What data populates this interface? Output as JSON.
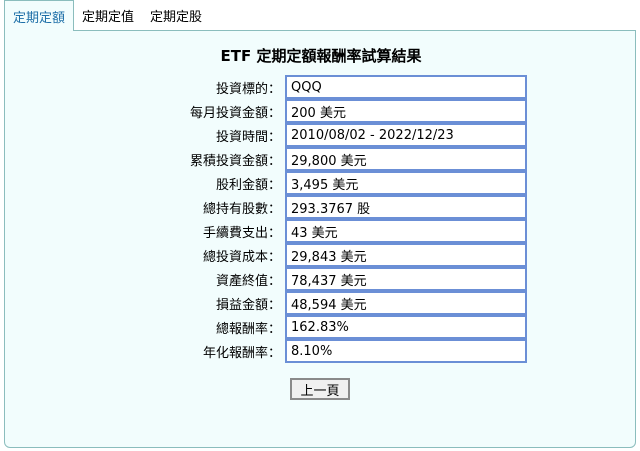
{
  "tabs": [
    {
      "label": "定期定額",
      "active": true
    },
    {
      "label": "定期定值",
      "active": false
    },
    {
      "label": "定期定股",
      "active": false
    }
  ],
  "title": "ETF 定期定額報酬率試算結果",
  "results": [
    {
      "label": "投資標的：",
      "value": "QQQ"
    },
    {
      "label": "每月投資金額：",
      "value": "200 美元"
    },
    {
      "label": "投資時間：",
      "value": "2010/08/02 - 2022/12/23"
    },
    {
      "label": "累積投資金額：",
      "value": "29,800 美元"
    },
    {
      "label": "股利金額：",
      "value": "3,495 美元"
    },
    {
      "label": "總持有股數：",
      "value": "293.3767 股"
    },
    {
      "label": "手續費支出：",
      "value": "43 美元"
    },
    {
      "label": "總投資成本：",
      "value": "29,843 美元"
    },
    {
      "label": "資產終值：",
      "value": "78,437 美元"
    },
    {
      "label": "損益金額：",
      "value": "48,594 美元"
    },
    {
      "label": "總報酬率：",
      "value": "162.83%"
    },
    {
      "label": "年化報酬率：",
      "value": "8.10%"
    }
  ],
  "back_button": "上一頁",
  "colors": {
    "tab_active_text": "#1e6fa8",
    "panel_bg": "#f2fdfd",
    "panel_border": "#8bbdbd",
    "field_border": "#6b8fd6"
  }
}
